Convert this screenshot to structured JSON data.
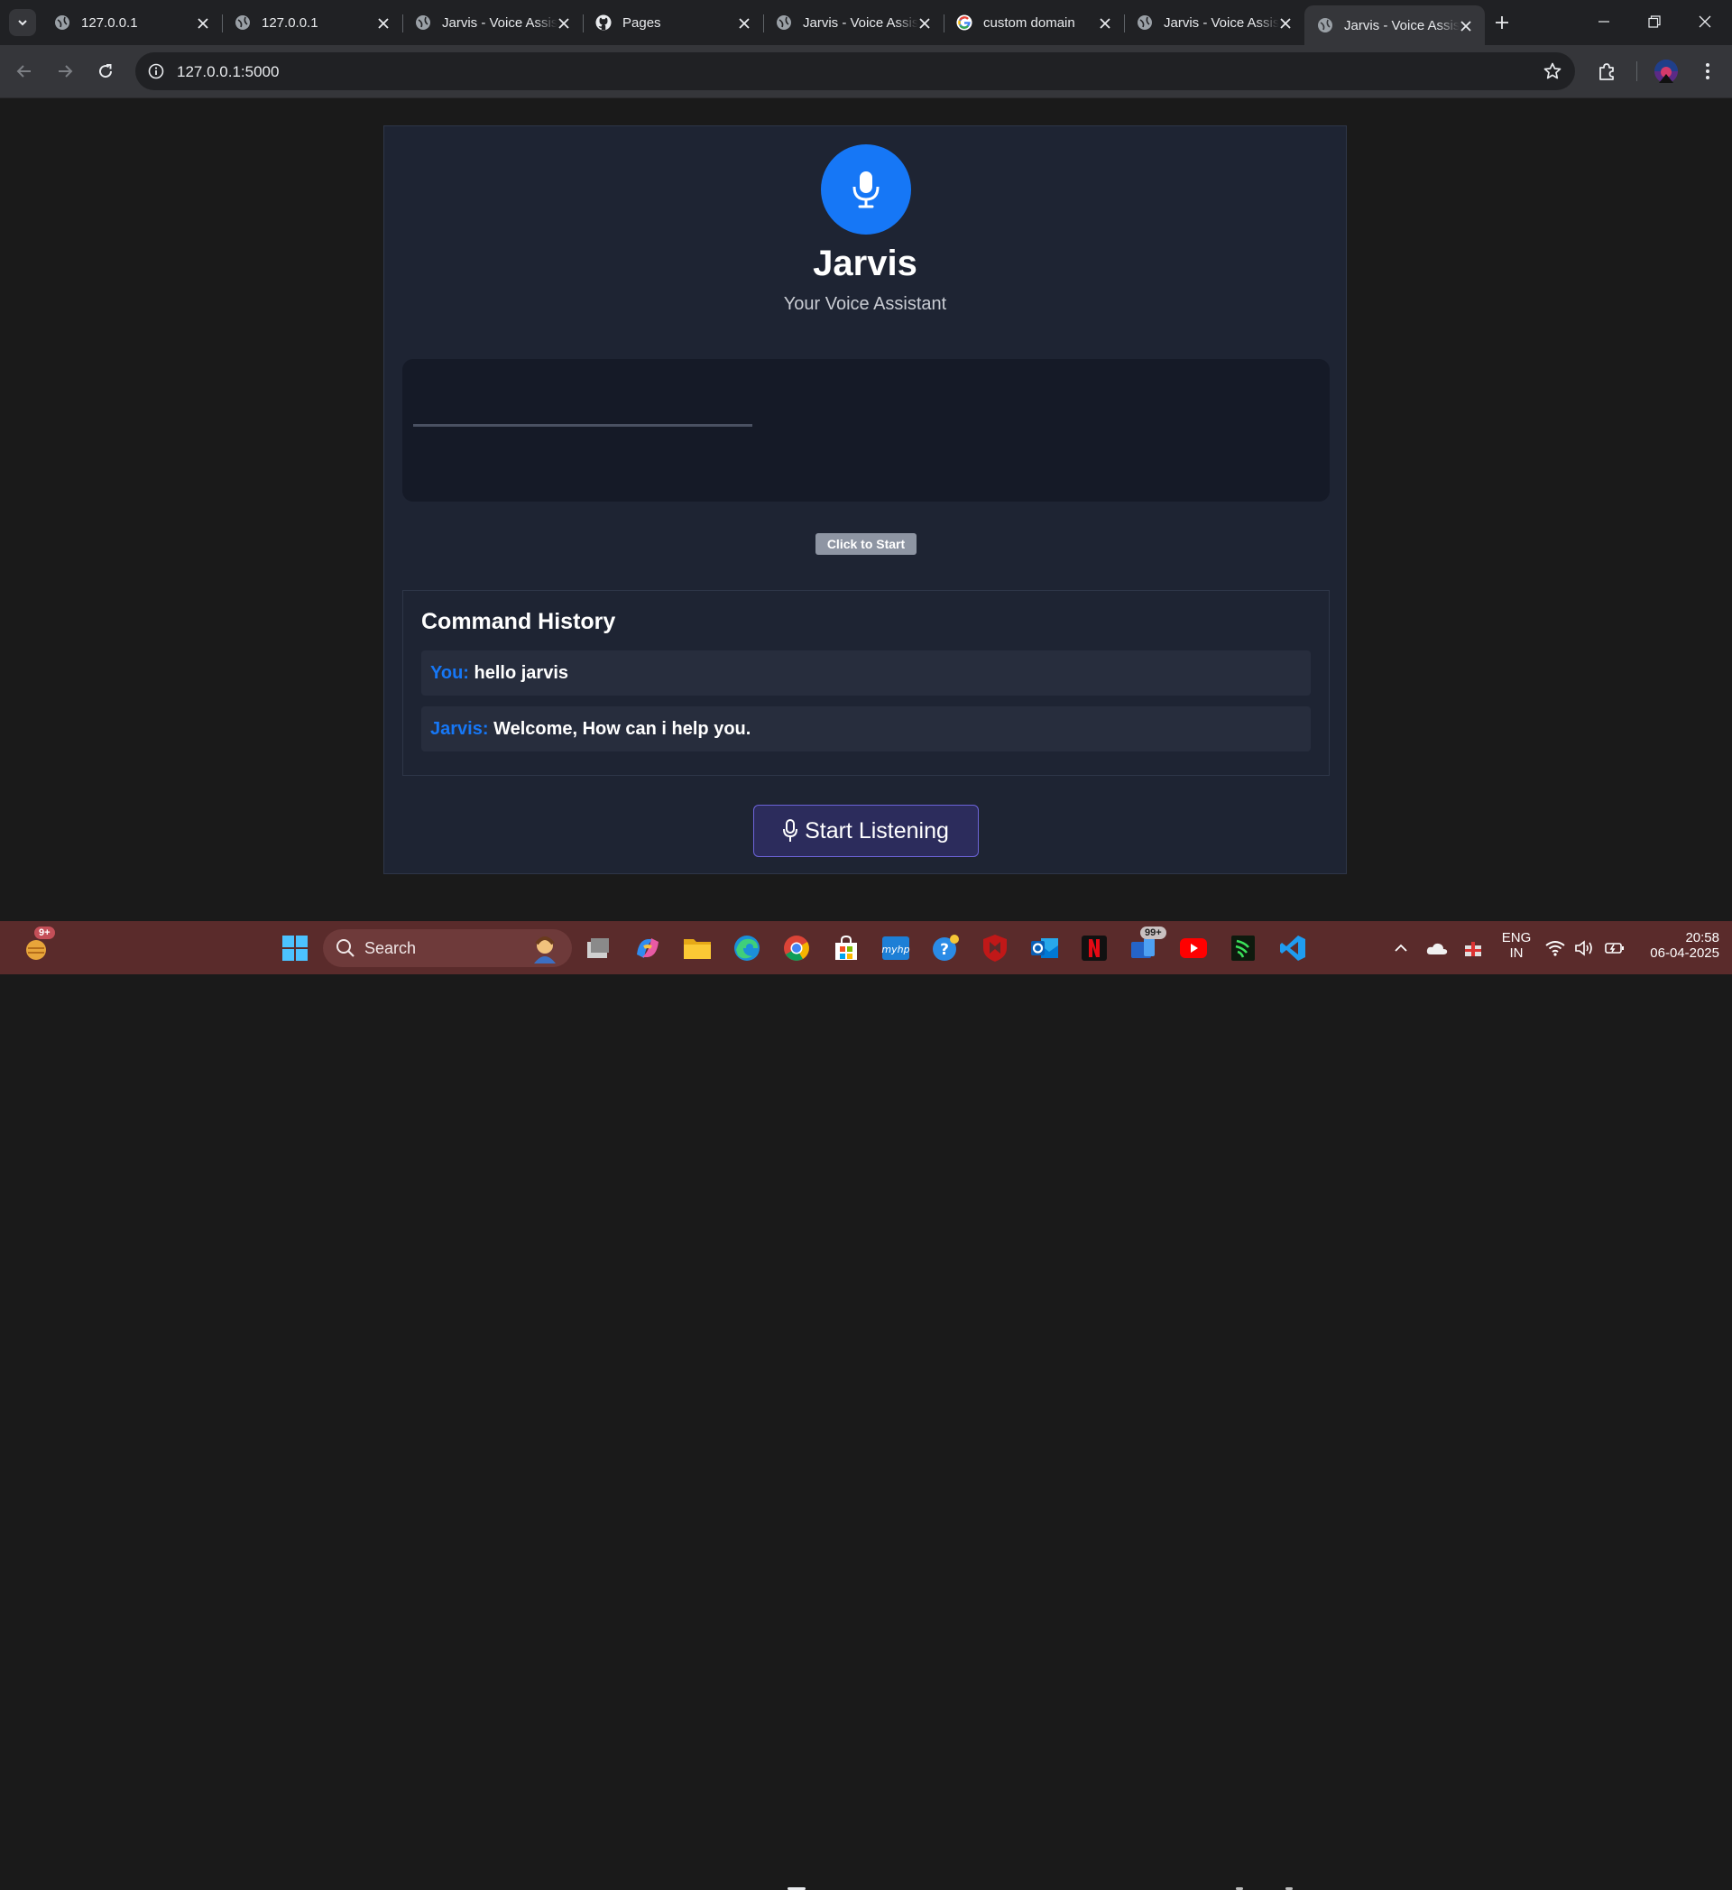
{
  "browser": {
    "tabs": [
      {
        "title": "127.0.0.1",
        "favicon": "globe-icon",
        "active": false
      },
      {
        "title": "127.0.0.1",
        "favicon": "globe-icon",
        "active": false
      },
      {
        "title": "Jarvis - Voice Assistant",
        "favicon": "globe-icon",
        "active": false
      },
      {
        "title": "Pages",
        "favicon": "github-icon",
        "active": false
      },
      {
        "title": "Jarvis - Voice Assistant",
        "favicon": "globe-icon",
        "active": false
      },
      {
        "title": "custom domain",
        "favicon": "google-icon",
        "active": false
      },
      {
        "title": "Jarvis - Voice Assistant",
        "favicon": "globe-icon",
        "active": false
      },
      {
        "title": "Jarvis - Voice Assistant",
        "favicon": "globe-icon",
        "active": true
      }
    ],
    "url": "127.0.0.1:5000"
  },
  "app": {
    "title": "Jarvis",
    "subtitle": "Your Voice Assistant",
    "click_to_start": "Click to Start",
    "history_title": "Command History",
    "history": [
      {
        "speaker": "You:",
        "message": "hello jarvis"
      },
      {
        "speaker": "Jarvis:",
        "message": "Welcome, How can i help you."
      }
    ],
    "listen_button": "Start Listening",
    "accent_color": "#1677f6"
  },
  "taskbar": {
    "search_placeholder": "Search",
    "widgets_badge": "9+",
    "store_badge": "99+",
    "language": "ENG",
    "region": "IN",
    "time": "20:58",
    "date": "06-04-2025"
  }
}
